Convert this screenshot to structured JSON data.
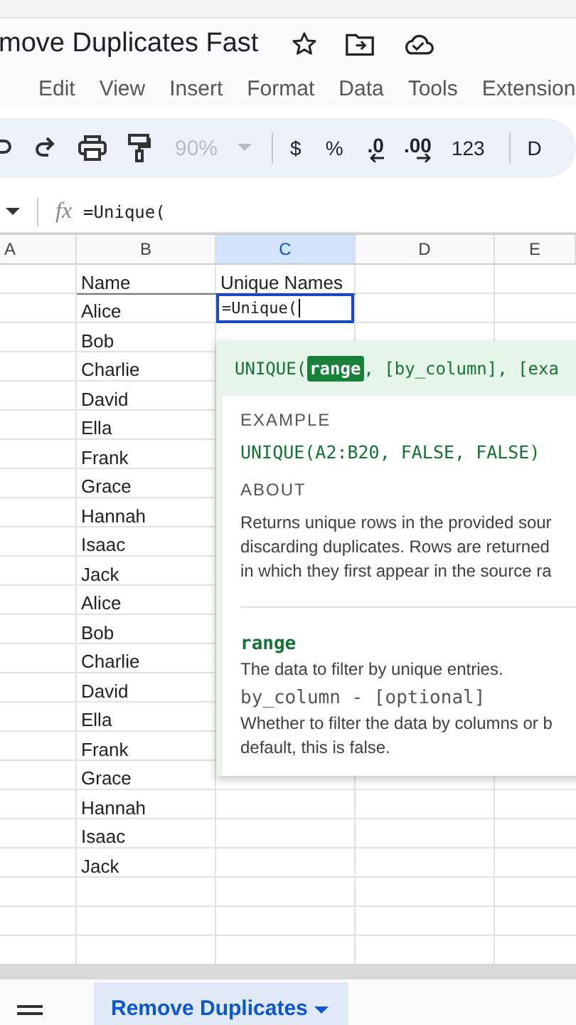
{
  "document": {
    "title": "move Duplicates Fast"
  },
  "menu": [
    "Edit",
    "View",
    "Insert",
    "Format",
    "Data",
    "Tools",
    "Extension"
  ],
  "toolbar": {
    "zoom": "90%",
    "zoom_disabled": true,
    "items": [
      {
        "kind": "text",
        "label": "$"
      },
      {
        "kind": "text",
        "label": "%"
      },
      {
        "kind": "decimal-less",
        "label": ".0"
      },
      {
        "kind": "decimal-more",
        "label": ".00"
      },
      {
        "kind": "text",
        "label": "123"
      },
      {
        "kind": "text",
        "label": "D"
      }
    ]
  },
  "formula_bar": {
    "fx": "fx",
    "formula": "=Unique("
  },
  "columns": [
    {
      "label": "A",
      "selected": false
    },
    {
      "label": "B",
      "selected": false
    },
    {
      "label": "C",
      "selected": true
    },
    {
      "label": "D",
      "selected": false
    },
    {
      "label": "E",
      "selected": false
    }
  ],
  "rows": [
    {
      "b": "Name",
      "c": "Unique Names",
      "c_editing": false
    },
    {
      "b": "Alice",
      "c": "=Unique(",
      "c_editing": true
    },
    {
      "b": "Bob"
    },
    {
      "b": "Charlie"
    },
    {
      "b": "David"
    },
    {
      "b": "Ella"
    },
    {
      "b": "Frank"
    },
    {
      "b": "Grace"
    },
    {
      "b": "Hannah"
    },
    {
      "b": "Isaac"
    },
    {
      "b": "Jack"
    },
    {
      "b": "Alice"
    },
    {
      "b": "Bob"
    },
    {
      "b": "Charlie"
    },
    {
      "b": "David"
    },
    {
      "b": "Ella"
    },
    {
      "b": "Frank"
    },
    {
      "b": "Grace"
    },
    {
      "b": "Hannah"
    },
    {
      "b": "Isaac"
    },
    {
      "b": "Jack"
    },
    {},
    {},
    {}
  ],
  "help_popup": {
    "signature": [
      {
        "text": "UNIQUE(",
        "highlighted": false
      },
      {
        "text": "range",
        "highlighted": true
      },
      {
        "text": ", [by_column], [exa",
        "highlighted": false
      }
    ],
    "example_heading": "EXAMPLE",
    "example": "UNIQUE(A2:B20, FALSE, FALSE)",
    "about_heading": "ABOUT",
    "about": "Returns unique rows in the provided sour\ndiscarding duplicates. Rows are returned\nin which they first appear in the source ra",
    "params": [
      {
        "name": "range",
        "required": true,
        "description": "The data to filter by unique entries."
      },
      {
        "name": "by_column - [optional]",
        "required": false,
        "description": "Whether to filter the data by columns or b\ndefault, this is false."
      }
    ]
  },
  "sheet_tabs": [
    {
      "label": "Remove Duplicates",
      "selected": true
    }
  ]
}
